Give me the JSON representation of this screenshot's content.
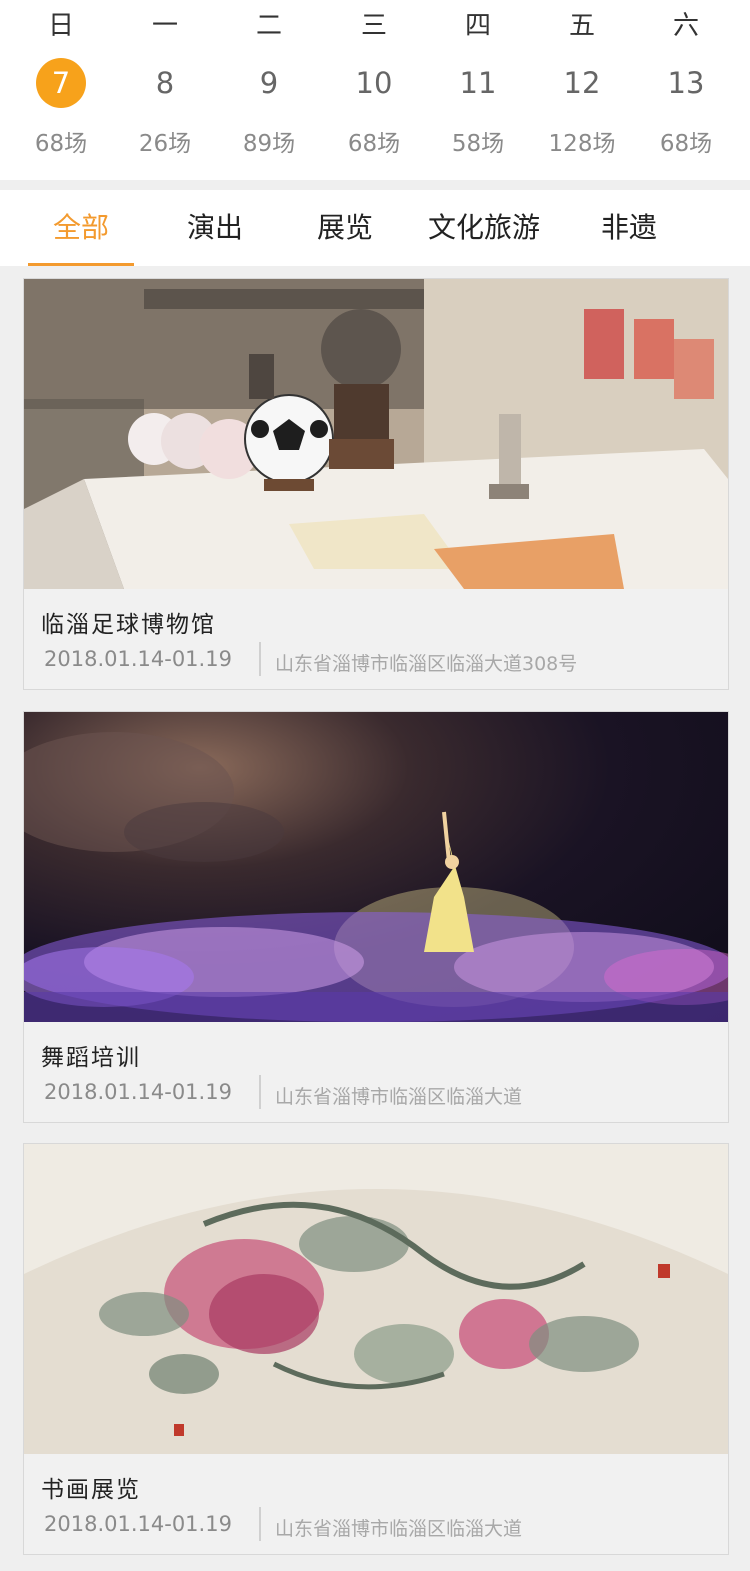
{
  "calendar": {
    "days": [
      {
        "weekday": "日",
        "date": "7",
        "count": "68场",
        "active": true
      },
      {
        "weekday": "一",
        "date": "8",
        "count": "26场"
      },
      {
        "weekday": "二",
        "date": "9",
        "count": "89场"
      },
      {
        "weekday": "三",
        "date": "10",
        "count": "68场"
      },
      {
        "weekday": "四",
        "date": "11",
        "count": "58场"
      },
      {
        "weekday": "五",
        "date": "12",
        "count": "128场"
      },
      {
        "weekday": "六",
        "date": "13",
        "count": "68场"
      }
    ],
    "active_color": "#f7a21b"
  },
  "tabs": [
    {
      "label": "全部",
      "active": true
    },
    {
      "label": "演出"
    },
    {
      "label": "展览"
    },
    {
      "label": "文化旅游"
    },
    {
      "label": "非遗"
    }
  ],
  "accent_color": "#f39a2e",
  "cards": [
    {
      "title": "临淄足球博物馆",
      "date": "2018.01.14-01.19",
      "address": "山东省淄博市临淄区临淄大道308号"
    },
    {
      "title": "舞蹈培训",
      "date": "2018.01.14-01.19",
      "address": "山东省淄博市临淄区临淄大道"
    },
    {
      "title": "书画展览",
      "date": "2018.01.14-01.19",
      "address": "山东省淄博市临淄区临淄大道"
    }
  ]
}
